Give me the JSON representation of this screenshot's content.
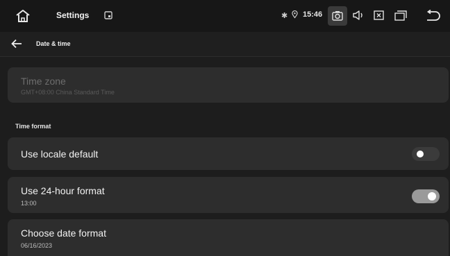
{
  "status_bar": {
    "title": "Settings",
    "time": "15:46",
    "icons": [
      "home-icon",
      "box-icon",
      "bluetooth-icon",
      "location-icon",
      "screenshot-icon",
      "volume-icon",
      "close-box-icon",
      "recent-apps-icon",
      "back-icon"
    ]
  },
  "app_bar": {
    "title": "Date & time"
  },
  "timezone": {
    "title": "Time zone",
    "value": "GMT+08:00 China Standard Time",
    "enabled": false
  },
  "section_time_format": "Time format",
  "settings": [
    {
      "title": "Use locale default",
      "subtitle": "",
      "toggle": false
    },
    {
      "title": "Use 24-hour format",
      "subtitle": "13:00",
      "toggle": true
    },
    {
      "title": "Choose date format",
      "subtitle": "06/16/2023"
    }
  ],
  "colors": {
    "background": "#1d1d1d",
    "card": "#2d2d2d",
    "status_bar": "#171717",
    "toggle_on": "#9a9a9a",
    "toggle_off": "#3b3b3b"
  }
}
